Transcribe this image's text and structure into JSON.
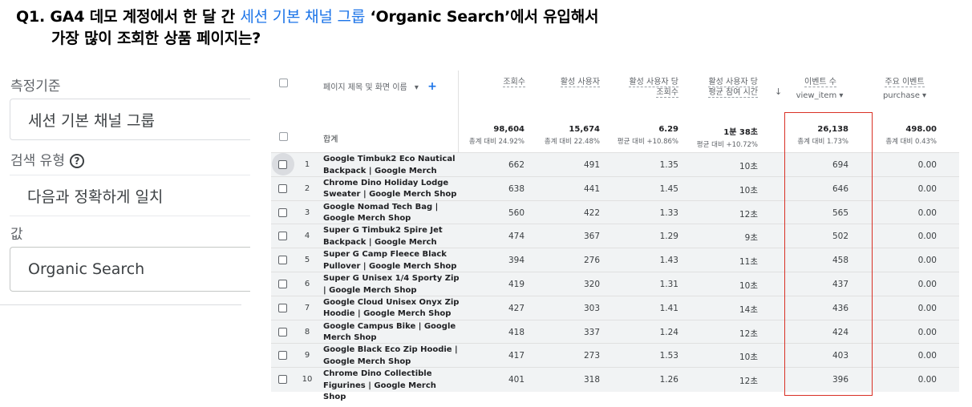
{
  "question": {
    "prefix": "Q1. GA4 데모 계정에서 한 달 간 ",
    "highlight": "세션 기본 채널 그룹",
    "suffix": " ‘Organic Search’에서 유입해서",
    "line2": "가장 많이 조회한 상품 페이지는?"
  },
  "filter": {
    "metric_label": "측정기준",
    "metric_value": "세션 기본 채널 그룹",
    "search_type_label": "검색 유형",
    "help_glyph": "?",
    "search_type_value": "다음과 정확하게 일치",
    "value_label": "값",
    "value_input": "Organic Search"
  },
  "table": {
    "dimension_header": "페이지 제목 및 화면 이름",
    "dropdown_glyph": "▾",
    "add_glyph": "+",
    "sort_glyph": "↓",
    "columns": [
      {
        "label": "조회수",
        "sub": ""
      },
      {
        "label": "활성 사용자",
        "sub": ""
      },
      {
        "label": "활성 사용자 당 조회수",
        "sub": ""
      },
      {
        "label": "활성 사용자 당 평균 참여 시간",
        "sub": ""
      },
      {
        "label": "이벤트 수",
        "sub": "view_item"
      },
      {
        "label": "주요 이벤트",
        "sub": "purchase"
      }
    ],
    "total_label": "합계",
    "totals": [
      {
        "value": "98,604",
        "sub": "총계 대비 24.92%"
      },
      {
        "value": "15,674",
        "sub": "총계 대비 22.48%"
      },
      {
        "value": "6.29",
        "sub": "평균 대비 +10.86%"
      },
      {
        "value": "1분 38초",
        "sub": "평균 대비 +10.72%"
      },
      {
        "value": "26,138",
        "sub": "총계 대비 1.73%"
      },
      {
        "value": "498.00",
        "sub": "총계 대비 0.43%"
      }
    ],
    "rows": [
      {
        "num": "1",
        "name": "Google Timbuk2 Eco Nautical Backpack | Google Merch Shop",
        "views": "662",
        "users": "491",
        "vpu": "1.35",
        "time": "10초",
        "events": "694",
        "key": "0.00"
      },
      {
        "num": "2",
        "name": "Chrome Dino Holiday Lodge Sweater | Google Merch Shop",
        "views": "638",
        "users": "441",
        "vpu": "1.45",
        "time": "10초",
        "events": "646",
        "key": "0.00"
      },
      {
        "num": "3",
        "name": "Google Nomad Tech Bag | Google Merch Shop",
        "views": "560",
        "users": "422",
        "vpu": "1.33",
        "time": "12초",
        "events": "565",
        "key": "0.00"
      },
      {
        "num": "4",
        "name": "Super G Timbuk2 Spire Jet Backpack | Google Merch Shop",
        "views": "474",
        "users": "367",
        "vpu": "1.29",
        "time": "9초",
        "events": "502",
        "key": "0.00"
      },
      {
        "num": "5",
        "name": "Super G Camp Fleece Black Pullover | Google Merch Shop",
        "views": "394",
        "users": "276",
        "vpu": "1.43",
        "time": "11초",
        "events": "458",
        "key": "0.00"
      },
      {
        "num": "6",
        "name": "Super G Unisex 1/4 Sporty Zip | Google Merch Shop",
        "views": "419",
        "users": "320",
        "vpu": "1.31",
        "time": "10초",
        "events": "437",
        "key": "0.00"
      },
      {
        "num": "7",
        "name": "Google Cloud Unisex Onyx Zip Hoodie | Google Merch Shop",
        "views": "427",
        "users": "303",
        "vpu": "1.41",
        "time": "14초",
        "events": "436",
        "key": "0.00"
      },
      {
        "num": "8",
        "name": "Google Campus Bike | Google Merch Shop",
        "views": "418",
        "users": "337",
        "vpu": "1.24",
        "time": "12초",
        "events": "424",
        "key": "0.00"
      },
      {
        "num": "9",
        "name": "Google Black Eco Zip Hoodie | Google Merch Shop",
        "views": "417",
        "users": "273",
        "vpu": "1.53",
        "time": "10초",
        "events": "403",
        "key": "0.00"
      },
      {
        "num": "10",
        "name": "Chrome Dino Collectible Figurines | Google Merch Shop",
        "views": "401",
        "users": "318",
        "vpu": "1.26",
        "time": "12초",
        "events": "396",
        "key": "0.00"
      }
    ]
  },
  "colors": {
    "accent": "#1a73e8",
    "highlight_box": "#d93025"
  }
}
